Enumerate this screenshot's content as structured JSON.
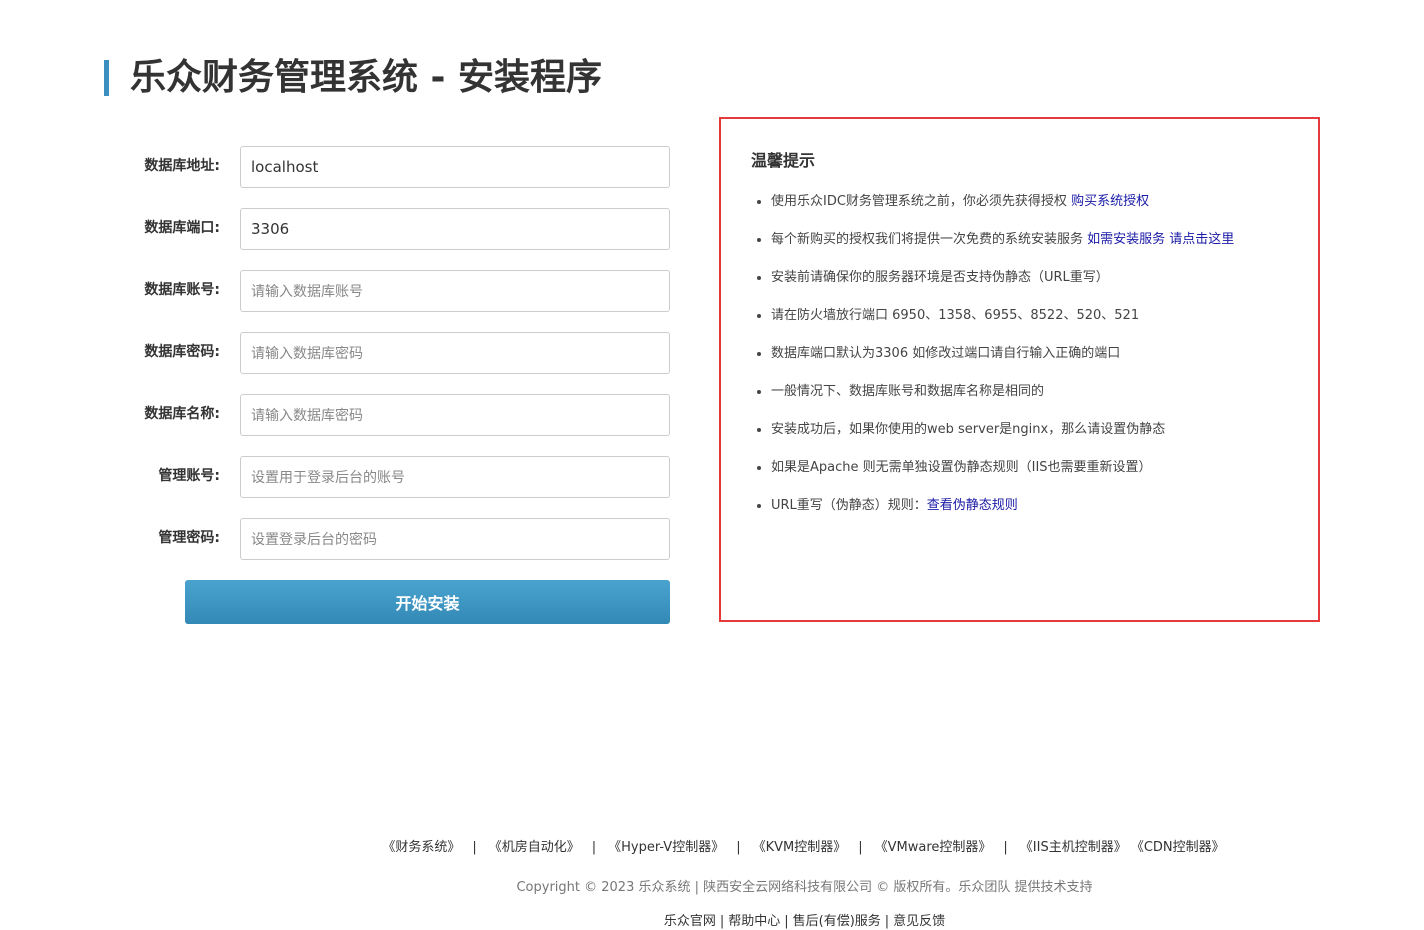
{
  "header": {
    "title": "乐众财务管理系统 - 安装程序"
  },
  "form": {
    "fields": [
      {
        "label": "数据库地址:",
        "value": "localhost",
        "placeholder": ""
      },
      {
        "label": "数据库端口:",
        "value": "3306",
        "placeholder": ""
      },
      {
        "label": "数据库账号:",
        "value": "",
        "placeholder": "请输入数据库账号"
      },
      {
        "label": "数据库密码:",
        "value": "",
        "placeholder": "请输入数据库密码"
      },
      {
        "label": "数据库名称:",
        "value": "",
        "placeholder": "请输入数据库密码"
      },
      {
        "label": "管理账号:",
        "value": "",
        "placeholder": "设置用于登录后台的账号"
      },
      {
        "label": "管理密码:",
        "value": "",
        "placeholder": "设置登录后台的密码"
      }
    ],
    "submit_label": "开始安装"
  },
  "tips": {
    "title": "温馨提示",
    "items": [
      {
        "text": "使用乐众IDC财务管理系统之前，你必须先获得授权 ",
        "link": "购买系统授权"
      },
      {
        "text": "每个新购买的授权我们将提供一次免费的系统安装服务 ",
        "link": "如需安装服务 请点击这里"
      },
      {
        "text": "安装前请确保你的服务器环境是否支持伪静态（URL重写）",
        "link": ""
      },
      {
        "text": "请在防火墙放行端口 6950、1358、6955、8522、520、521",
        "link": ""
      },
      {
        "text": "数据库端口默认为3306 如修改过端口请自行输入正确的端口",
        "link": ""
      },
      {
        "text": "一般情况下、数据库账号和数据库名称是相同的",
        "link": ""
      },
      {
        "text": "安装成功后，如果你使用的web server是nginx，那么请设置伪静态",
        "link": ""
      },
      {
        "text": "如果是Apache 则无需单独设置伪静态规则（IIS也需要重新设置）",
        "link": ""
      },
      {
        "text": "URL重写（伪静态）规则：",
        "link": "查看伪静态规则"
      }
    ]
  },
  "footer": {
    "products": [
      "《财务系统》",
      "《机房自动化》",
      "《Hyper-V控制器》",
      "《KVM控制器》",
      "《VMware控制器》",
      "《IIS主机控制器》",
      "《CDN控制器》"
    ],
    "copyright": "Copyright © 2023 乐众系统 | 陕西安全云网络科技有限公司 © 版权所有。乐众团队 提供技术支持",
    "links": [
      "乐众官网",
      "帮助中心",
      "售后(有偿)服务",
      "意见反馈"
    ]
  }
}
